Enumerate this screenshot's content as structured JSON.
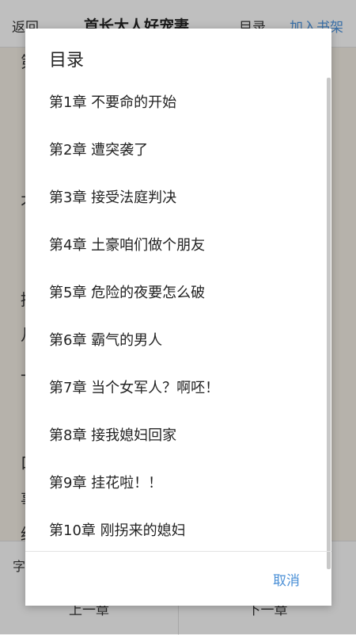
{
  "topbar": {
    "back_label": "返回",
    "book_title": "首长大人好宠妻",
    "toc_label": "目录",
    "add_shelf_label": "加入书架"
  },
  "content": {
    "fragments": [
      "第",
      "不",
      "接",
      "凡",
      "一",
      "口",
      "事",
      "绝"
    ]
  },
  "bottombar": {
    "font_label": "字",
    "prev_label": "上一章",
    "next_label": "下一章"
  },
  "dialog": {
    "title": "目录",
    "chapters": [
      "第1章 不要命的开始",
      "第2章 遭突袭了",
      "第3章 接受法庭判决",
      "第4章 土豪咱们做个朋友",
      "第5章 危险的夜要怎么破",
      "第6章 霸气的男人",
      "第7章 当个女军人？啊呸！",
      "第8章 接我媳妇回家",
      "第9章 挂花啦！！",
      "第10章 刚拐来的媳妇"
    ],
    "cancel_label": "取消"
  }
}
